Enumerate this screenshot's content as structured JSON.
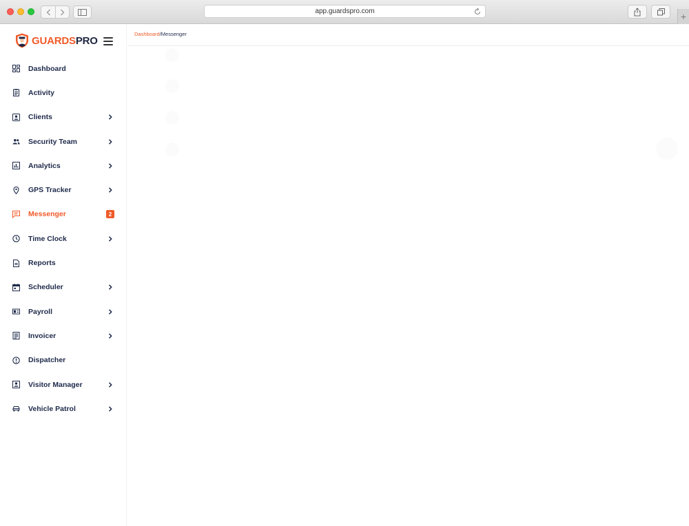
{
  "browser": {
    "url": "app.guardspro.com",
    "new_tab_label": "+"
  },
  "brand": {
    "part1": "GUARDS",
    "part2": "PRO",
    "color_primary": "#f05a28",
    "color_secondary": "#1e2640"
  },
  "sidebar": {
    "items": [
      {
        "label": "Dashboard",
        "icon": "dashboard-icon",
        "has_chevron": false
      },
      {
        "label": "Activity",
        "icon": "clipboard-icon",
        "has_chevron": false
      },
      {
        "label": "Clients",
        "icon": "client-card-icon",
        "has_chevron": true
      },
      {
        "label": "Security Team",
        "icon": "people-icon",
        "has_chevron": true
      },
      {
        "label": "Analytics",
        "icon": "analytics-icon",
        "has_chevron": true
      },
      {
        "label": "GPS Tracker",
        "icon": "location-pin-icon",
        "has_chevron": true
      },
      {
        "label": "Messenger",
        "icon": "chat-icon",
        "has_chevron": false,
        "active": true,
        "badge": "2"
      },
      {
        "label": "Time Clock",
        "icon": "clock-icon",
        "has_chevron": true
      },
      {
        "label": "Reports",
        "icon": "report-icon",
        "has_chevron": false
      },
      {
        "label": "Scheduler",
        "icon": "calendar-icon",
        "has_chevron": true
      },
      {
        "label": "Payroll",
        "icon": "payroll-icon",
        "has_chevron": true
      },
      {
        "label": "Invoicer",
        "icon": "invoice-icon",
        "has_chevron": true
      },
      {
        "label": "Dispatcher",
        "icon": "dispatch-icon",
        "has_chevron": false
      },
      {
        "label": "Visitor Manager",
        "icon": "visitor-badge-icon",
        "has_chevron": true
      },
      {
        "label": "Vehicle Patrol",
        "icon": "car-icon",
        "has_chevron": true
      }
    ]
  },
  "breadcrumb": {
    "link": "Dashboard",
    "separator": "/",
    "current": "Messenger"
  }
}
